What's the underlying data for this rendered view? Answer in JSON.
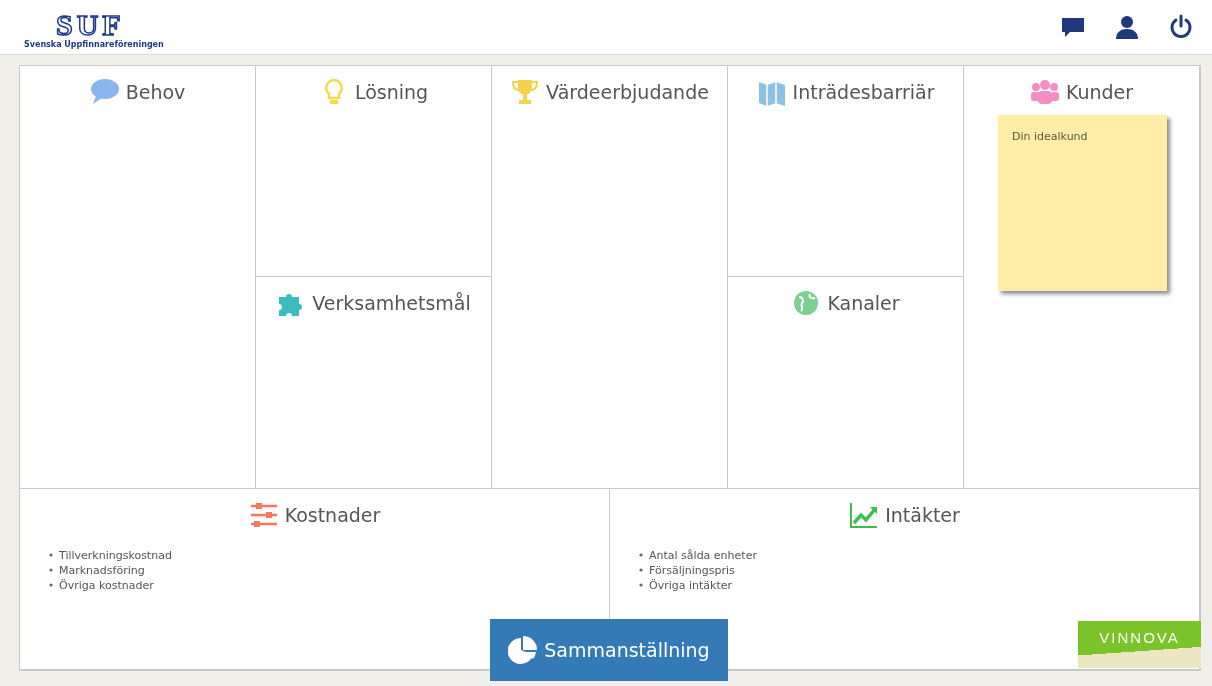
{
  "header": {
    "logo": {
      "mark": "SUF",
      "subtitle": "Svenska Uppfinnareföreningen"
    }
  },
  "canvas": {
    "blocks": [
      {
        "title": "Behov"
      },
      {
        "title": "Lösning"
      },
      {
        "title": "Verksamhetsmål"
      },
      {
        "title": "Värdeerbjudande"
      },
      {
        "title": "Inträdesbarriär"
      },
      {
        "title": "Kanaler"
      },
      {
        "title": "Kunder",
        "notes": [
          "Din idealkund"
        ]
      },
      {
        "title": "Kostnader",
        "bullets": [
          "Tillverkningskostnad",
          "Marknadsföring",
          "Övriga kostnader"
        ]
      },
      {
        "title": "Intäkter",
        "bullets": [
          "Antal sålda enheter",
          "Försäljningspris",
          "Övriga intäkter"
        ]
      }
    ]
  },
  "summary_button": {
    "label": "Sammanställning"
  },
  "sponsor_logo": {
    "text": "VINNOVA"
  }
}
